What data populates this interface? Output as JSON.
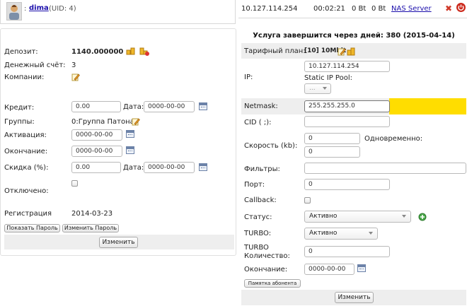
{
  "user": {
    "login": "dima",
    "uid_text": "(UID: 4)",
    "colon": ":"
  },
  "session": {
    "ip": "10.127.114.254",
    "duration": "00:02:21",
    "in": "0 Bt",
    "out": "0 Bt",
    "nas": "NAS Server"
  },
  "left": {
    "deposit_label": "Депозит:",
    "deposit_value": "1140.000000",
    "bill_label": "Денежный счёт:",
    "bill_value": "3",
    "companies_label": "Компании:",
    "credit_label": "Кредит:",
    "credit_value": "0.00",
    "credit_date_label": "Дата:",
    "credit_date_value": "0000-00-00",
    "groups_label": "Группы:",
    "groups_value": "0:Группа Патона",
    "activation_label": "Активация:",
    "activation_value": "0000-00-00",
    "expire_label": "Окончание:",
    "expire_value": "0000-00-00",
    "discount_label": "Скидка (%):",
    "discount_value": "0.00",
    "discount_date_label": "Дата:",
    "discount_date_value": "0000-00-00",
    "disabled_label": "Отключено:",
    "registration_label": "Регистрация",
    "registration_value": "2014-03-23",
    "show_password": "Показать Пароль",
    "change_password": "Изменить Пароль",
    "submit": "Изменить"
  },
  "right": {
    "service_header": "Услуга завершится через дней: 380 (2015-04-14)",
    "tariff_label": "Тарифный план:",
    "tariff_value": "[10] 10Mbit",
    "ip_label": "IP:",
    "ip_value": "10.127.114.254",
    "static_pool_label": "Static IP Pool:",
    "static_pool_select": "...",
    "netmask_label": "Netmask:",
    "netmask_value": "255.255.255.0",
    "cid_label": "CID ( ;):",
    "cid_value": "",
    "speed_label": "Скорость (kb):",
    "speed_value1": "0",
    "simultaneous_label": "Одновременно:",
    "simultaneous_value": "0",
    "filters_label": "Фильтры:",
    "filters_value": "",
    "port_label": "Порт:",
    "port_value": "0",
    "callback_label": "Callback:",
    "status_label": "Статус:",
    "status_value": "Активно",
    "turbo_label": "TURBO:",
    "turbo_value": "Активно",
    "turbo_count_label1": "TURBO",
    "turbo_count_label2": "Количество:",
    "turbo_count_value": "0",
    "expire_label": "Окончание:",
    "expire_value": "0000-00-00",
    "memo_button": "Памятка абонента",
    "submit": "Изменить"
  },
  "colors": {
    "highlight": "#ffdd00",
    "link": "#1a0dab",
    "panel": "#eeeeee"
  }
}
